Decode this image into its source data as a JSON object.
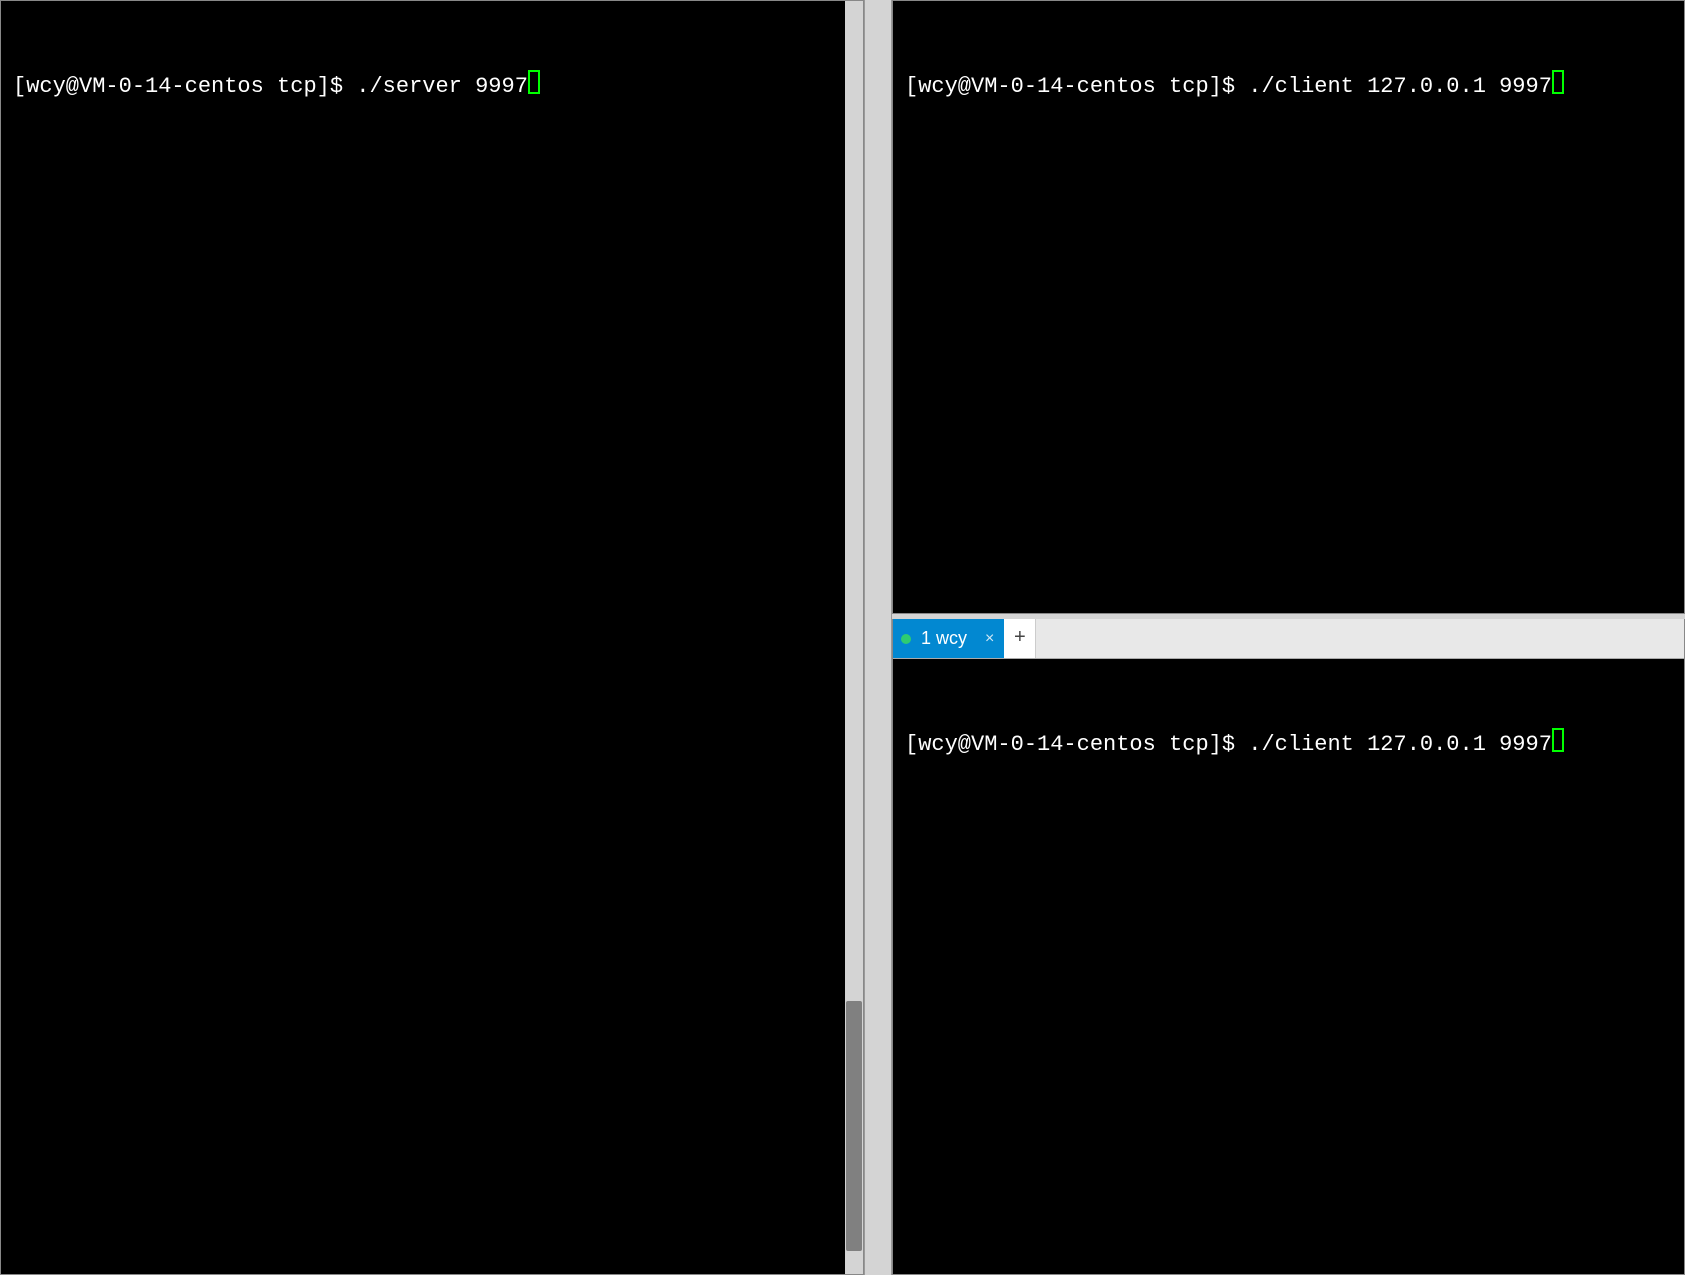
{
  "left_pane": {
    "prompt": "[wcy@VM-0-14-centos tcp]$ ",
    "command": "./server 9997"
  },
  "right_top_pane": {
    "prompt": "[wcy@VM-0-14-centos tcp]$ ",
    "command": "./client 127.0.0.1 9997"
  },
  "right_bottom_pane": {
    "tab": {
      "status": "connected",
      "label": "1 wcy",
      "close_glyph": "×"
    },
    "add_tab_glyph": "+",
    "prompt": "[wcy@VM-0-14-centos tcp]$ ",
    "command": "./client 127.0.0.1 9997"
  }
}
